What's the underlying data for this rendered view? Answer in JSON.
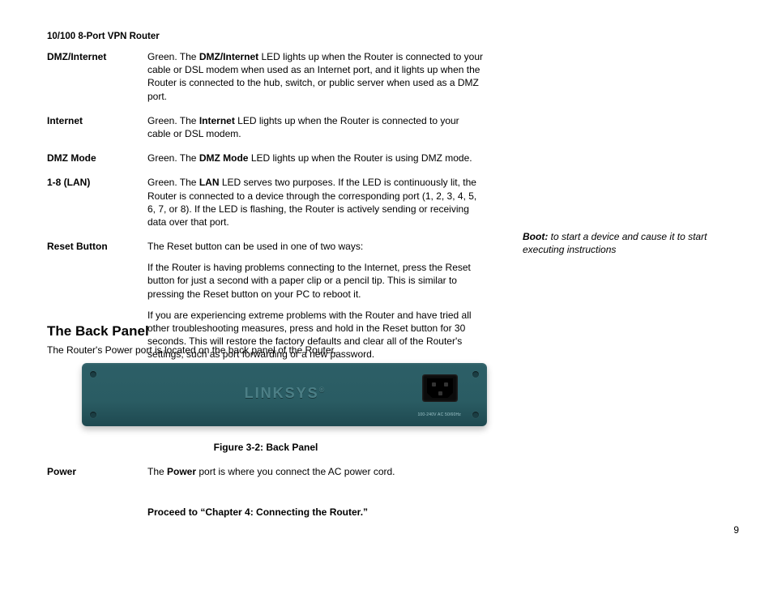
{
  "product_name": "10/100 8-Port VPN Router",
  "defs": [
    {
      "term": "DMZ/Internet",
      "html": "Green. The <b>DMZ/Internet</b> LED lights up when the Router is connected to your cable or DSL modem when used as an Internet port, and it lights up when the Router is connected to the hub, switch, or public server when used as a DMZ port."
    },
    {
      "term": "Internet",
      "html": "Green. The <b>Internet</b> LED lights up when the Router is connected to your cable or DSL modem."
    },
    {
      "term": "DMZ Mode",
      "html": "Green. The <b>DMZ Mode</b> LED lights up when the Router is using DMZ mode."
    },
    {
      "term": "1-8 (LAN)",
      "html": "Green. The <b>LAN</b> LED serves two purposes. If the LED is continuously lit, the Router is connected to a device through the corresponding port (1, 2, 3, 4, 5, 6, 7, or 8). If the LED is flashing, the Router is actively sending or receiving data over that port."
    },
    {
      "term": "Reset Button",
      "paras": [
        "The Reset button can be used in one of two ways:",
        "If the Router is having problems connecting to the Internet, press the Reset button for just a second with a paper clip or a pencil tip. This is similar to pressing the Reset button on your PC to reboot it.",
        "If you are experiencing extreme problems with the Router and have tried all other troubleshooting measures, press and hold in the Reset button for 30 seconds. This will restore the factory defaults and clear all of the Router's settings, such as port forwarding or a new password."
      ]
    }
  ],
  "section_heading": "The Back Panel",
  "section_intro": "The Router's Power port is located on the back panel of the Router.",
  "device_logo": "LINKSYS",
  "device_rating": "100-240V AC 50/60Hz",
  "figure_caption": "Figure 3-2: Back Panel",
  "defs2": [
    {
      "term": "Power",
      "html": "The <b>Power</b> port is where you connect the AC power cord."
    }
  ],
  "proceed": "Proceed to “Chapter 4: Connecting the Router.”",
  "sidenote_html": "<b>Boot:</b> to start a device and cause it to start executing instructions",
  "page_number": "9"
}
